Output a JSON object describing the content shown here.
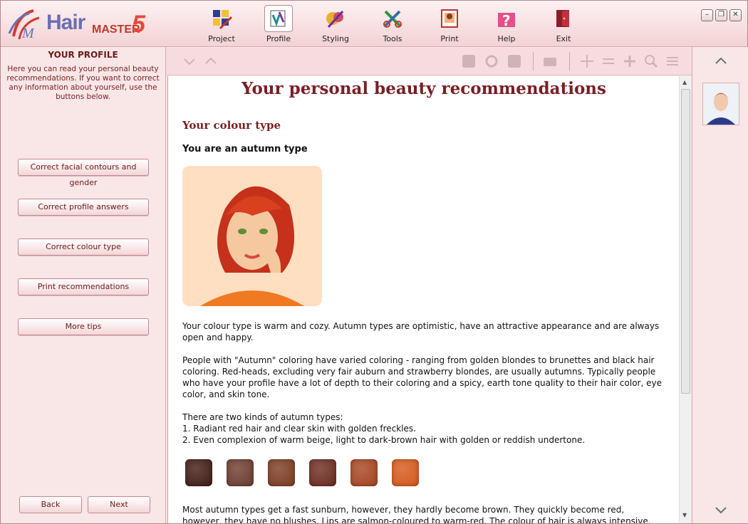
{
  "app": {
    "logo": {
      "hair": "Hair",
      "master": "MASTER",
      "version": "5"
    }
  },
  "nav": [
    {
      "label": "Project",
      "icon": "project-icon"
    },
    {
      "label": "Profile",
      "icon": "profile-icon",
      "active": true
    },
    {
      "label": "Styling",
      "icon": "styling-icon"
    },
    {
      "label": "Tools",
      "icon": "tools-icon"
    },
    {
      "label": "Print",
      "icon": "print-icon"
    },
    {
      "label": "Help",
      "icon": "help-icon"
    },
    {
      "label": "Exit",
      "icon": "exit-icon"
    }
  ],
  "window": {
    "minimize": "–",
    "restore": "❐",
    "close": "✕"
  },
  "left": {
    "title": "YOUR PROFILE",
    "description": "Here you can read your personal beauty recommendations. If you want to correct any information about yourself, use the buttons below.",
    "buttons": [
      "Correct facial contours and gender",
      "Correct profile answers",
      "Correct colour type",
      "Print recommendations",
      "More tips"
    ],
    "back": "Back",
    "next": "Next"
  },
  "content": {
    "title": "Your personal beauty recommendations",
    "section": "Your colour type",
    "subtitle": "You are an autumn type",
    "p1": "Your colour type is warm and cozy. Autumn types are optimistic, have an attractive appearance and are always open and happy.",
    "p2": "People with \"Autumn\" coloring have varied coloring - ranging from golden blondes to brunettes and black hair coloring. Red-heads, excluding very fair auburn and strawberry blondes, are usually autumns. Typically people who have your profile have a lot of depth to their coloring and a spicy, earth tone quality to their hair color, eye color, and skin tone.",
    "p3a": "There are two kinds of autumn types:",
    "p3b": "1. Radiant red hair and clear skin with golden freckles.",
    "p3c": "2. Even complexion of warm beige, light to dark-brown hair with golden or reddish undertone.",
    "p4": "Most autumn types get a fast sunburn, however, they hardly become brown. They quickly become red, however, they have no blushes. Lips are salmon-coloured to warm-red. The colour of hair is always intensive, clearly saturated as",
    "swatches": [
      "#3e1a12",
      "#6b3a2c",
      "#7a3a1e",
      "#6a2a1e",
      "#a4431f",
      "#d4561b"
    ]
  },
  "colors": {
    "accent": "#7a1f24",
    "panel": "#f9e6e7",
    "border": "#d7a9ac"
  }
}
